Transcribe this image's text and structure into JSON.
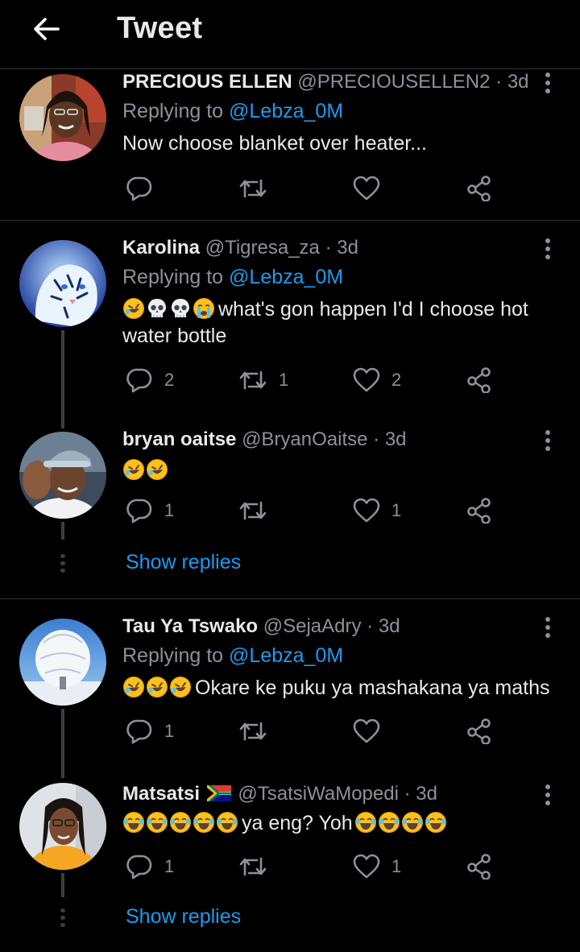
{
  "header": {
    "title": "Tweet",
    "back_icon": "arrow-left-icon"
  },
  "tweets": [
    {
      "name": "PRECIOUS ELLEN",
      "handle": "@PRECIOUSELLEN2",
      "dot": "·",
      "time": "3d",
      "replying_prefix": "Replying to ",
      "replying_to": "@Lebza_0M",
      "text": "Now choose blanket over heater...",
      "replies": "",
      "retweets": "",
      "likes": ""
    },
    {
      "name": "Karolina",
      "handle": "@Tigresa_za",
      "dot": "·",
      "time": "3d",
      "replying_prefix": "Replying to ",
      "replying_to": "@Lebza_0M",
      "emojis": [
        "rofl",
        "skull",
        "skull",
        "sob"
      ],
      "text": "what's gon happen I'd I choose hot water bottle",
      "replies": "2",
      "retweets": "1",
      "likes": "2"
    },
    {
      "name": "bryan oaitse",
      "handle": "@BryanOaitse",
      "dot": "·",
      "time": "3d",
      "emojis": [
        "rofl",
        "rofl"
      ],
      "text": "",
      "replies": "1",
      "retweets": "",
      "likes": "1",
      "show_replies": "Show replies"
    },
    {
      "name": "Tau Ya Tswako",
      "handle": "@SejaAdry",
      "dot": "·",
      "time": "3d",
      "replying_prefix": "Replying to ",
      "replying_to": "@Lebza_0M",
      "emojis": [
        "rofl",
        "rofl",
        "rofl"
      ],
      "text": "Okare ke puku ya mashakana ya maths",
      "replies": "1",
      "retweets": "",
      "likes": ""
    },
    {
      "name": "Matsatsi",
      "flag": "south-africa-flag",
      "handle": "@TsatsiWaMopedi",
      "dot": "·",
      "time": "3d",
      "emojis_before": [
        "joy",
        "joy",
        "joy",
        "joy",
        "joy"
      ],
      "text": "ya eng? Yoh",
      "emojis_after": [
        "joy",
        "joy",
        "joy",
        "joy"
      ],
      "replies": "1",
      "retweets": "",
      "likes": "1",
      "show_replies": "Show replies"
    }
  ],
  "icons": {
    "reply": "reply-icon",
    "retweet": "retweet-icon",
    "like": "heart-icon",
    "share": "share-icon",
    "more": "more-vertical-icon"
  },
  "colors": {
    "background": "#000000",
    "text": "#e7e9ea",
    "secondary": "#8b9298",
    "link": "#1d9bf0",
    "divider": "#2f3336"
  }
}
